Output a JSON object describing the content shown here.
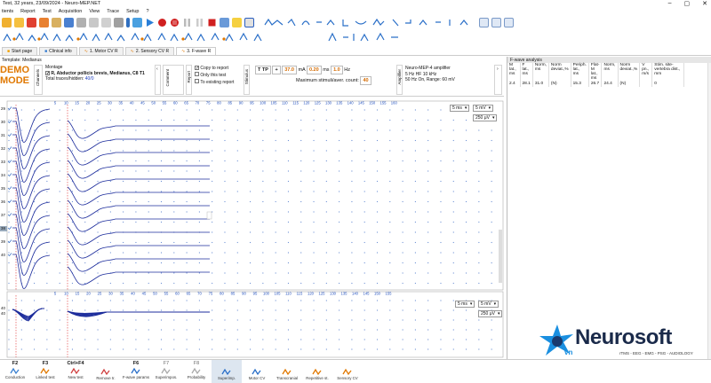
{
  "window": {
    "title": "Test, 32 years, 23/09/2024 - Neuro-MEP.NET",
    "minimize": "–",
    "maximize": "▢",
    "close": "✕"
  },
  "menu": [
    "tients",
    "Report",
    "Test",
    "Acquisition",
    "View",
    "Trace",
    "Setup",
    "?"
  ],
  "tabs": [
    {
      "label": "Start page"
    },
    {
      "label": "Clinical info"
    },
    {
      "label": "1. Motor CV R"
    },
    {
      "label": "2. Sensory CV R"
    },
    {
      "label": "3. F-wave R",
      "active": true
    }
  ],
  "template": {
    "label": "Template: Medianus"
  },
  "demo": {
    "line1": "DEMO",
    "line2": "MODE"
  },
  "channels": {
    "label": "Channels",
    "montage_label": "Montage",
    "montage_value": "R, Abductor pollicis brevis, Medianus, C8 T1",
    "total_label": "Total traces/hidden:",
    "total_value": "40/0"
  },
  "comment": {
    "label": "Comment"
  },
  "report": {
    "label": "Report",
    "copy": "Copy to report",
    "only_this": "Only this test",
    "existing": "To existing report"
  },
  "stimulus": {
    "label": "Stimulus",
    "ttp": "T TP",
    "plus": "+",
    "amp": "37.0",
    "amp_unit": "mA",
    "dur": "0.20",
    "dur_unit": "ms",
    "freq": "1.0",
    "freq_unit": "Hz",
    "max_label": "Maximum stimuli/aver. count:",
    "max_value": "40"
  },
  "amplifier": {
    "label": "Amplifier",
    "name": "Neuro-MEP-4 amplifier",
    "filters": "5 Hz  HF  10 kHz",
    "notch": "50 Hz  On, Range: 60 mV"
  },
  "top_plot": {
    "ticks": [
      "5",
      "10",
      "15",
      "20",
      "25",
      "30",
      "35",
      "40",
      "45",
      "50",
      "55",
      "60",
      "65",
      "70",
      "75",
      "80",
      "85",
      "90",
      "95",
      "100",
      "105",
      "110",
      "115",
      "120",
      "125",
      "130",
      "135",
      "140",
      "145",
      "150",
      "155",
      "160"
    ],
    "sweep": "5 ms",
    "sens": "5 mV",
    "sens2": "250 μV",
    "trace_numbers": [
      "29",
      "30",
      "31",
      "32",
      "33",
      "34",
      "35",
      "36",
      "37",
      "38",
      "39",
      "40"
    ],
    "selected_trace": "38"
  },
  "bottom_plot": {
    "ticks": [
      "5",
      "10",
      "15",
      "20",
      "25",
      "30",
      "35",
      "40",
      "45",
      "50",
      "55",
      "60",
      "65",
      "70",
      "75",
      "80",
      "85",
      "90",
      "95",
      "100",
      "105",
      "110",
      "115",
      "120",
      "125",
      "130",
      "135",
      "140",
      "145",
      "150",
      "155"
    ],
    "sweep": "5 ms",
    "sens": "5 mV",
    "sens2": "250 μV",
    "labels": [
      "40",
      "40"
    ]
  },
  "fwave": {
    "title": "F-wave analysis",
    "headers": [
      "M lat., ms",
      "F lat., ms",
      "Norm, ms",
      "Norm deviat.,%",
      "Periph. lat., ms",
      "Flat-M lat., ms",
      "Norm, ms",
      "Norm deviat.,%",
      "V pn., m/s",
      "Stim. site-vertebra dist., mm"
    ],
    "row": [
      "2.4",
      "28.1",
      "31.0",
      "(N)",
      "15.3",
      "26.7",
      "24.4",
      "(N)",
      "",
      "0"
    ]
  },
  "fkeys": [
    {
      "key": "F2",
      "label": "Conduction"
    },
    {
      "key": "F3",
      "label": "Linked test"
    },
    {
      "key": "Ctrl+F4",
      "label": "New test"
    },
    {
      "key": "",
      "label": "Remove tr."
    },
    {
      "key": "F6",
      "label": "F-wave params"
    },
    {
      "key": "F7",
      "label": "Superimpos.",
      "dim": true
    },
    {
      "key": "F8",
      "label": "Probability",
      "dim": true
    },
    {
      "key": "",
      "label": "Superimp.",
      "selected": true
    },
    {
      "key": "",
      "label": "Motor CV"
    },
    {
      "key": "",
      "label": "Transcranial"
    },
    {
      "key": "",
      "label": "Repetitive st."
    },
    {
      "key": "",
      "label": "Sensory CV"
    }
  ],
  "logo": {
    "name": "Neurosoft",
    "suffix": "vn",
    "tagline": "rTMS - EEG - EMG - PSG - AUDIOLOGY"
  },
  "colors": {
    "accent": "#0a5fc7",
    "trace": "#1d2d9c",
    "grid": "#6b8fd4",
    "demo": "#e07800",
    "value": "#d46a00",
    "logo_blue": "#1a8fe0"
  }
}
